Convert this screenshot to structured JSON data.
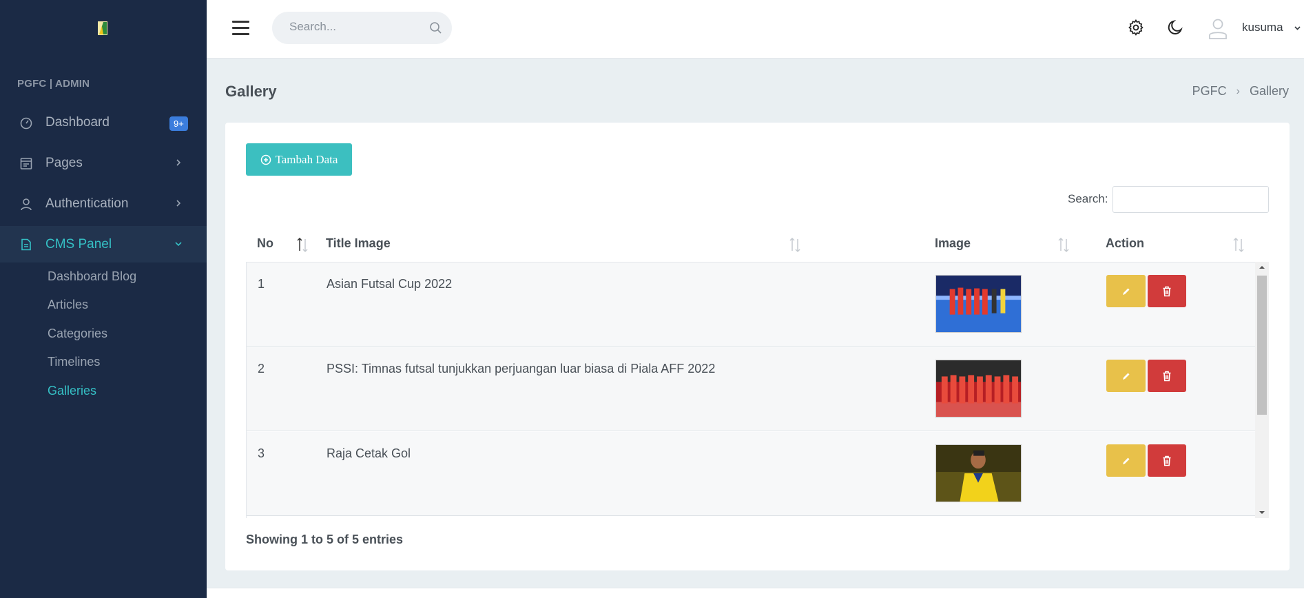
{
  "sidebar": {
    "brand": "PGFC | ADMIN",
    "items": [
      {
        "label": "Dashboard",
        "icon": "speedometer-icon",
        "badge": "9+"
      },
      {
        "label": "Pages",
        "icon": "layout-icon"
      },
      {
        "label": "Authentication",
        "icon": "user-icon"
      },
      {
        "label": "CMS Panel",
        "icon": "file-text-icon"
      }
    ],
    "sub_items": [
      "Dashboard Blog",
      "Articles",
      "Categories",
      "Timelines",
      "Galleries"
    ]
  },
  "topbar": {
    "search_placeholder": "Search...",
    "user": "kusuma"
  },
  "page": {
    "title": "Gallery",
    "breadcrumb": [
      "PGFC",
      "Gallery"
    ]
  },
  "table": {
    "add_button": "Tambah Data",
    "search_label": "Search:",
    "columns": [
      "No",
      "Title Image",
      "Image",
      "Action"
    ],
    "rows": [
      {
        "no": "1",
        "title": "Asian Futsal Cup 2022",
        "image": "futsal-team-blue-court"
      },
      {
        "no": "2",
        "title": "PSSI: Timnas futsal tunjukkan perjuangan luar biasa di Piala AFF 2022",
        "image": "futsal-team-red-court"
      },
      {
        "no": "3",
        "title": "Raja Cetak Gol",
        "image": "player-yellow-jersey"
      }
    ],
    "info": "Showing 1 to 5 of 5 entries"
  },
  "colors": {
    "sidebar_bg": "#1b2a45",
    "accent": "#35c0c5",
    "edit": "#e8c14a",
    "delete": "#d13b3b",
    "badge": "#3b7ddd"
  }
}
